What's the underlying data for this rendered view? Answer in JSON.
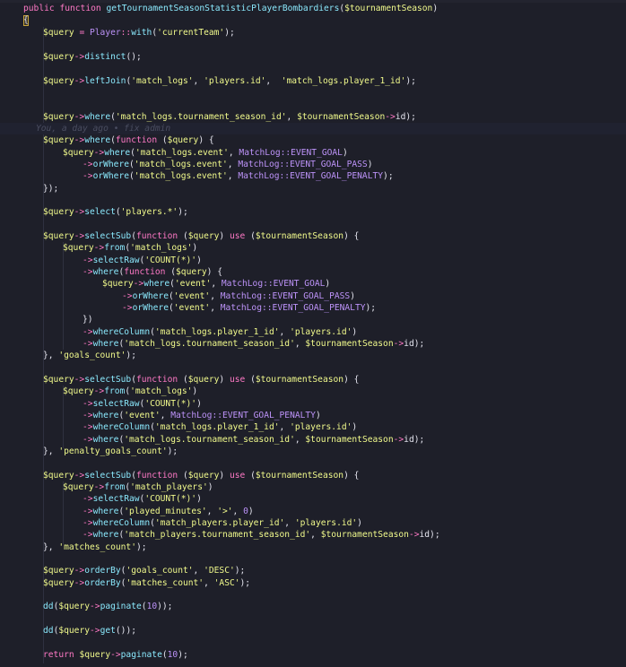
{
  "editor": {
    "blame": "You, a day ago • fix admin",
    "lines": [
      {
        "id": "l1",
        "text": "public function getTournamentSeasonStatisticPlayerBombardiers($tournamentSeason)"
      },
      {
        "id": "l2",
        "text": "{"
      },
      {
        "id": "l3",
        "text": "$query = Player::with('currentTeam');"
      },
      {
        "id": "l4",
        "text": "$query->distinct();"
      },
      {
        "id": "l5",
        "text": "$query->leftJoin('match_logs', 'players.id',  'match_logs.player_1_id');"
      },
      {
        "id": "l6",
        "text": "$query->where('match_logs.tournament_season_id', $tournamentSeason->id);"
      },
      {
        "id": "l7",
        "text": "$query->where(function ($query) {"
      },
      {
        "id": "l8",
        "text": "$query->where('match_logs.event', MatchLog::EVENT_GOAL)"
      },
      {
        "id": "l9",
        "text": "->orWhere('match_logs.event', MatchLog::EVENT_GOAL_PASS)"
      },
      {
        "id": "l10",
        "text": "->orWhere('match_logs.event', MatchLog::EVENT_GOAL_PENALTY);"
      },
      {
        "id": "l11",
        "text": "});"
      },
      {
        "id": "l12",
        "text": "$query->select('players.*');"
      },
      {
        "id": "l13",
        "text": "$query->selectSub(function ($query) use ($tournamentSeason) {"
      },
      {
        "id": "l14",
        "text": "$query->from('match_logs')"
      },
      {
        "id": "l15",
        "text": "->selectRaw('COUNT(*)')"
      },
      {
        "id": "l16",
        "text": "->where(function ($query) {"
      },
      {
        "id": "l17",
        "text": "$query->where('event', MatchLog::EVENT_GOAL)"
      },
      {
        "id": "l18",
        "text": "->orWhere('event', MatchLog::EVENT_GOAL_PASS)"
      },
      {
        "id": "l19",
        "text": "->orWhere('event', MatchLog::EVENT_GOAL_PENALTY);"
      },
      {
        "id": "l20",
        "text": "})"
      },
      {
        "id": "l21",
        "text": "->whereColumn('match_logs.player_1_id', 'players.id')"
      },
      {
        "id": "l22",
        "text": "->where('match_logs.tournament_season_id', $tournamentSeason->id);"
      },
      {
        "id": "l23",
        "text": "}, 'goals_count');"
      },
      {
        "id": "l24",
        "text": "$query->selectSub(function ($query) use ($tournamentSeason) {"
      },
      {
        "id": "l25",
        "text": "$query->from('match_logs')"
      },
      {
        "id": "l26",
        "text": "->selectRaw('COUNT(*)')"
      },
      {
        "id": "l27",
        "text": "->where('event', MatchLog::EVENT_GOAL_PENALTY)"
      },
      {
        "id": "l28",
        "text": "->whereColumn('match_logs.player_1_id', 'players.id')"
      },
      {
        "id": "l29",
        "text": "->where('match_logs.tournament_season_id', $tournamentSeason->id);"
      },
      {
        "id": "l30",
        "text": "}, 'penalty_goals_count');"
      },
      {
        "id": "l31",
        "text": "$query->selectSub(function ($query) use ($tournamentSeason) {"
      },
      {
        "id": "l32",
        "text": "$query->from('match_players')"
      },
      {
        "id": "l33",
        "text": "->selectRaw('COUNT(*)')"
      },
      {
        "id": "l34",
        "text": "->where('played_minutes', '>', 0)"
      },
      {
        "id": "l35",
        "text": "->whereColumn('match_players.player_id', 'players.id')"
      },
      {
        "id": "l36",
        "text": "->where('match_players.tournament_season_id', $tournamentSeason->id);"
      },
      {
        "id": "l37",
        "text": "}, 'matches_count');"
      },
      {
        "id": "l38",
        "text": "$query->orderBy('goals_count', 'DESC');"
      },
      {
        "id": "l39",
        "text": "$query->orderBy('matches_count', 'ASC');"
      },
      {
        "id": "l40",
        "text": "dd($query->paginate(10));"
      },
      {
        "id": "l41",
        "text": "dd($query->get());"
      },
      {
        "id": "l42",
        "text": "return $query->paginate(10);"
      }
    ]
  },
  "colors": {
    "background": "#1e1f29",
    "keyword": "#ff79c6",
    "function": "#8be9fd",
    "string": "#f1fa8c",
    "constant": "#bd93f9"
  }
}
